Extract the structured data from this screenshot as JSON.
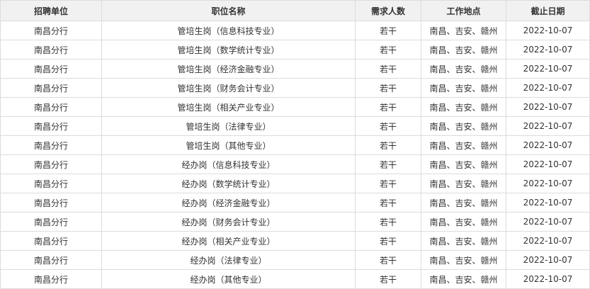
{
  "table": {
    "headers": [
      "招聘单位",
      "职位名称",
      "需求人数",
      "工作地点",
      "截止日期"
    ],
    "rows": [
      [
        "南昌分行",
        "管培生岗（信息科技专业）",
        "若干",
        "南昌、吉安、赣州",
        "2022-10-07"
      ],
      [
        "南昌分行",
        "管培生岗（数学统计专业）",
        "若干",
        "南昌、吉安、赣州",
        "2022-10-07"
      ],
      [
        "南昌分行",
        "管培生岗（经济金融专业）",
        "若干",
        "南昌、吉安、赣州",
        "2022-10-07"
      ],
      [
        "南昌分行",
        "管培生岗（财务会计专业）",
        "若干",
        "南昌、吉安、赣州",
        "2022-10-07"
      ],
      [
        "南昌分行",
        "管培生岗（相关产业专业）",
        "若干",
        "南昌、吉安、赣州",
        "2022-10-07"
      ],
      [
        "南昌分行",
        "管培生岗（法律专业）",
        "若干",
        "南昌、吉安、赣州",
        "2022-10-07"
      ],
      [
        "南昌分行",
        "管培生岗（其他专业）",
        "若干",
        "南昌、吉安、赣州",
        "2022-10-07"
      ],
      [
        "南昌分行",
        "经办岗（信息科技专业）",
        "若干",
        "南昌、吉安、赣州",
        "2022-10-07"
      ],
      [
        "南昌分行",
        "经办岗（数学统计专业）",
        "若干",
        "南昌、吉安、赣州",
        "2022-10-07"
      ],
      [
        "南昌分行",
        "经办岗（经济金融专业）",
        "若干",
        "南昌、吉安、赣州",
        "2022-10-07"
      ],
      [
        "南昌分行",
        "经办岗（财务会计专业）",
        "若干",
        "南昌、吉安、赣州",
        "2022-10-07"
      ],
      [
        "南昌分行",
        "经办岗（相关产业专业）",
        "若干",
        "南昌、吉安、赣州",
        "2022-10-07"
      ],
      [
        "南昌分行",
        "经办岗（法律专业）",
        "若干",
        "南昌、吉安、赣州",
        "2022-10-07"
      ],
      [
        "南昌分行",
        "经办岗（其他专业）",
        "若干",
        "南昌、吉安、赣州",
        "2022-10-07"
      ]
    ]
  }
}
